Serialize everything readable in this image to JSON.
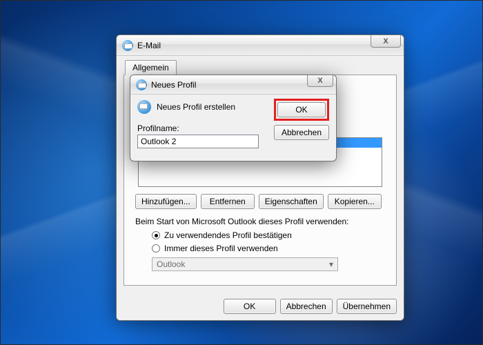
{
  "desktop": {},
  "email_dialog": {
    "title": "E-Mail",
    "close_label": "X",
    "tab_label": "Allgemein",
    "profile_list": {
      "selected_item": ""
    },
    "buttons": {
      "add": "Hinzufügen...",
      "remove": "Entfernen",
      "properties": "Eigenschaften",
      "copy": "Kopieren..."
    },
    "start_section": {
      "label": "Beim Start von Microsoft Outlook dieses Profil verwenden:",
      "radio_confirm": "Zu verwendendes Profil bestätigen",
      "radio_always": "Immer dieses Profil verwenden",
      "selected": "confirm",
      "combo_value": "Outlook"
    },
    "footer": {
      "ok": "OK",
      "cancel": "Abbrechen",
      "apply": "Übernehmen"
    }
  },
  "profile_dialog": {
    "title": "Neues Profil",
    "close_label": "X",
    "instruction": "Neues Profil erstellen",
    "ok_label": "OK",
    "cancel_label": "Abbrechen",
    "profilename_label": "Profilname:",
    "profilename_value": "Outlook 2"
  }
}
